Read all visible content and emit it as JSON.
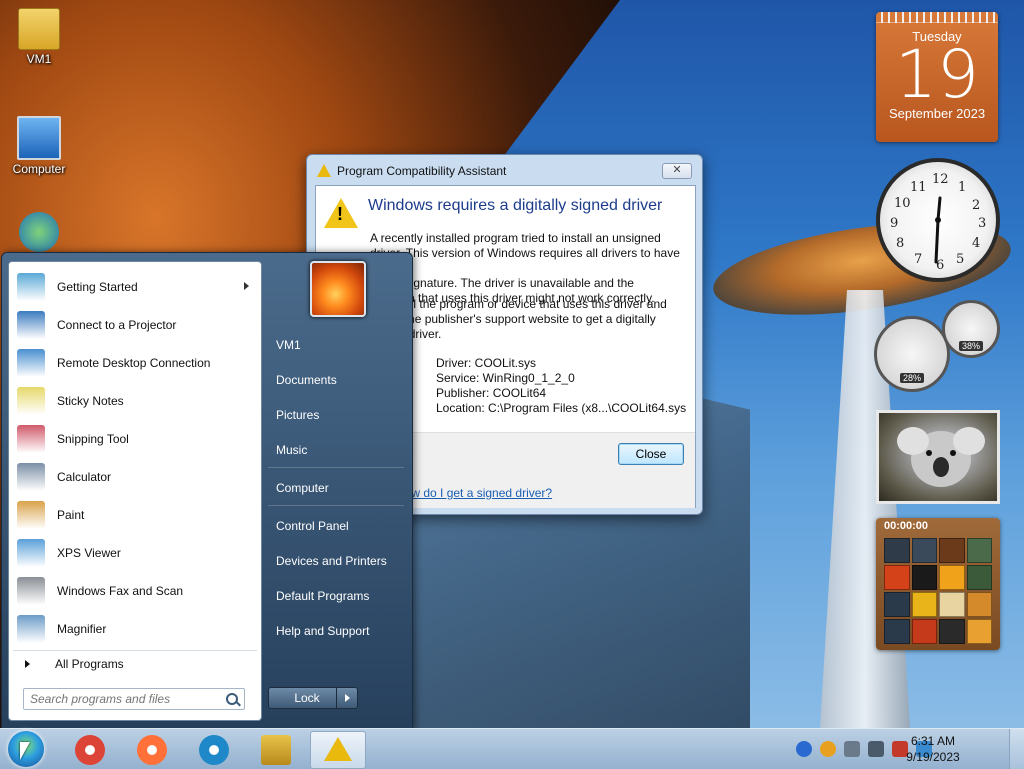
{
  "desktop": {
    "icons": [
      {
        "label": "VM1",
        "icon": "user-folder-icon"
      },
      {
        "label": "Computer",
        "icon": "computer-icon"
      }
    ]
  },
  "gadgets": {
    "calendar": {
      "weekday": "Tuesday",
      "day": "19",
      "month": "September 2023"
    },
    "clock": {
      "numerals": [
        "12",
        "1",
        "2",
        "3",
        "4",
        "5",
        "6",
        "7",
        "8",
        "9",
        "10",
        "11"
      ]
    },
    "meters": {
      "cpu_percent": "28%",
      "memory_percent": "38%"
    },
    "puzzle": {
      "timer": "00:00:00"
    }
  },
  "dialog": {
    "title": "Program Compatibility Assistant",
    "close_x": "✕",
    "heading": "Windows requires a digitally signed driver",
    "message_lines": [
      "A recently installed program tried to install an unsigned",
      "driver. This version of Windows requires all drivers to have a",
      "digital signature. The driver is unavailable and the",
      "program that uses this driver might not work correctly."
    ],
    "message2_lines": [
      "Uninstall the program or device that uses this driver and",
      "check the publisher's support website to get a digitally",
      "signed driver."
    ],
    "details": [
      "Driver: COOLit.sys",
      "Service: WinRing0_1_2_0",
      "Publisher: COOLit64",
      "Location: C:\\Program Files (x8...\\COOLit64.sys"
    ],
    "close_button": "Close",
    "link_text": "How do I get a signed driver?"
  },
  "start_menu": {
    "pinned": [
      {
        "label": "Getting Started",
        "icon": "getting-started-icon",
        "has_submenu": true,
        "color": "#5aa9d6"
      },
      {
        "label": "Connect to a Projector",
        "icon": "projector-icon",
        "has_submenu": false,
        "color": "#3c7bbf"
      },
      {
        "label": "Remote Desktop Connection",
        "icon": "remote-desktop-icon",
        "has_submenu": false,
        "color": "#4a8fd0"
      },
      {
        "label": "Sticky Notes",
        "icon": "sticky-notes-icon",
        "has_submenu": false,
        "color": "#e6d96a"
      },
      {
        "label": "Snipping Tool",
        "icon": "scissors-icon",
        "has_submenu": false,
        "color": "#d05a6a"
      },
      {
        "label": "Calculator",
        "icon": "calculator-icon",
        "has_submenu": false,
        "color": "#7b8fa6"
      },
      {
        "label": "Paint",
        "icon": "paint-palette-icon",
        "has_submenu": false,
        "color": "#d9a24a"
      },
      {
        "label": "XPS Viewer",
        "icon": "xps-viewer-icon",
        "has_submenu": false,
        "color": "#5aa0d8"
      },
      {
        "label": "Windows Fax and Scan",
        "icon": "fax-icon",
        "has_submenu": false,
        "color": "#8a8f96"
      },
      {
        "label": "Magnifier",
        "icon": "magnifier-icon",
        "has_submenu": false,
        "color": "#6c9cc8"
      }
    ],
    "all_programs": "All Programs",
    "search_placeholder": "Search programs and files",
    "right_items": [
      "VM1",
      "Documents",
      "Pictures",
      "Music",
      "Computer",
      "Control Panel",
      "Devices and Printers",
      "Default Programs",
      "Help and Support"
    ],
    "lock_label": "Lock"
  },
  "taskbar": {
    "apps": [
      {
        "name": "chrome",
        "icon": "chrome-icon",
        "color": "#db4437"
      },
      {
        "name": "firefox",
        "icon": "firefox-icon",
        "color": "#ff7139"
      },
      {
        "name": "edge",
        "icon": "edge-icon",
        "color": "#1e88c8"
      },
      {
        "name": "explorer",
        "icon": "folder-icon",
        "color": "#e8c34a"
      },
      {
        "name": "compatibility-assistant",
        "icon": "warning-icon",
        "color": "#e9b90e"
      }
    ],
    "tray_icons": [
      "l-icon",
      "search-icon",
      "volume-muted-icon",
      "network-icon",
      "flag-icon",
      "battery-icon"
    ],
    "time": "6:31 AM",
    "date": "9/19/2023"
  }
}
